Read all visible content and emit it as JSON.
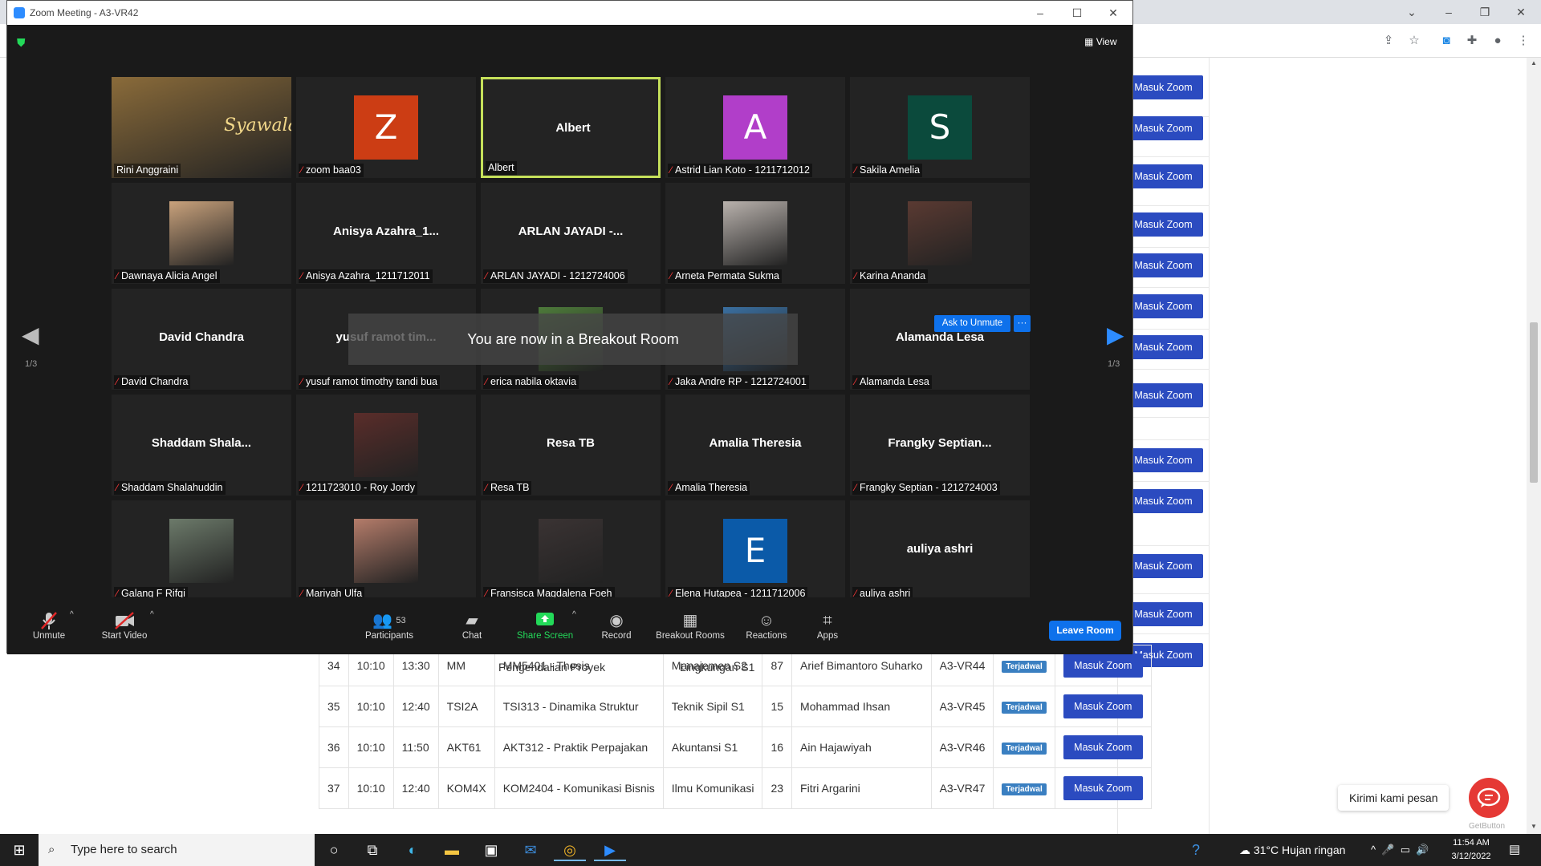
{
  "zoom": {
    "window_title": "Zoom Meeting - A3-VR42",
    "view_label": "View",
    "page_left": "1/3",
    "page_right": "1/3",
    "breakout_message": "You are now in a Breakout Room",
    "ask_unmute_label": "Ask to Unmute",
    "more_label": "···",
    "tiles": [
      {
        "name": "Rini Anggraini",
        "kind": "photo",
        "photo_text": "Syawala",
        "color": "#8a6b3a"
      },
      {
        "name": "zoom baa03",
        "kind": "letter",
        "letter": "Z",
        "color": "#cc3d14"
      },
      {
        "name": "Albert",
        "kind": "bigname",
        "big": "Albert",
        "active": true
      },
      {
        "name": "Astrid Lian Koto - 1211712012",
        "kind": "letter",
        "letter": "A",
        "color": "#b13ec9"
      },
      {
        "name": "Sakila Amelia",
        "kind": "letter",
        "letter": "S",
        "color": "#0b4a3c"
      },
      {
        "name": "Dawnaya Alicia Angel",
        "kind": "photo",
        "color": "#c9a27c"
      },
      {
        "name": "Anisya Azahra_1211712011",
        "kind": "bigname",
        "big": "Anisya  Azahra_1..."
      },
      {
        "name": "ARLAN JAYADI - 1212724006",
        "kind": "bigname",
        "big": "ARLAN JAYADI -..."
      },
      {
        "name": "Arneta Permata Sukma",
        "kind": "photo",
        "color": "#b9b2ad"
      },
      {
        "name": "Karina Ananda",
        "kind": "photo",
        "color": "#5a3a32"
      },
      {
        "name": "David Chandra",
        "kind": "bigname",
        "big": "David Chandra"
      },
      {
        "name": "yusuf ramot timothy tandi bua",
        "kind": "bigname",
        "big": "yusuf ramot tim..."
      },
      {
        "name": "erica nabila oktavia",
        "kind": "photo",
        "color": "#4d7a3a"
      },
      {
        "name": "Jaka Andre RP - 1212724001",
        "kind": "photo",
        "color": "#3a6fa0"
      },
      {
        "name": "Alamanda Lesa",
        "kind": "bigname",
        "big": "Alamanda Lesa"
      },
      {
        "name": "Shaddam Shalahuddin",
        "kind": "bigname",
        "big": "Shaddam  Shala..."
      },
      {
        "name": "1211723010 - Roy Jordy",
        "kind": "photo",
        "color": "#5a2d2a"
      },
      {
        "name": "Resa TB",
        "kind": "bigname",
        "big": "Resa TB"
      },
      {
        "name": "Amalia Theresia",
        "kind": "bigname",
        "big": "Amalia Theresia"
      },
      {
        "name": "Frangky Septian - 1212724003",
        "kind": "bigname",
        "big": "Frangky  Septian..."
      },
      {
        "name": "Galang F Rifqi",
        "kind": "photo",
        "color": "#6c7a6a"
      },
      {
        "name": "Mariyah Ulfa",
        "kind": "photo",
        "color": "#b47c6a"
      },
      {
        "name": "Fransisca Magdalena Foeh",
        "kind": "photo",
        "color": "#3a3333"
      },
      {
        "name": "Elena Hutapea - 1211712006",
        "kind": "letter",
        "letter": "E",
        "color": "#0b5aa8"
      },
      {
        "name": "auliya ashri",
        "kind": "bigname",
        "big": "auliya ashri"
      }
    ],
    "controls": {
      "unmute": "Unmute",
      "start_video": "Start Video",
      "participants": "Participants",
      "participants_count": "53",
      "chat": "Chat",
      "share_screen": "Share Screen",
      "record": "Record",
      "breakout_rooms": "Breakout Rooms",
      "reactions": "Reactions",
      "apps": "Apps",
      "leave_room": "Leave Room"
    }
  },
  "browser": {
    "masuk_zoom_label": "Masuk Zoom",
    "partial_row": {
      "course": "Pengendalian Proyek",
      "program": "Lingkungan S1"
    },
    "rows": [
      {
        "no": "34",
        "start": "10:10",
        "end": "13:30",
        "class": "MM",
        "course": "MM5401 - Thesis",
        "program": "Manajemen S2",
        "count": "87",
        "lecturer": "Arief Bimantoro Suharko",
        "room": "A3-VR44",
        "status": "Terjadwal"
      },
      {
        "no": "35",
        "start": "10:10",
        "end": "12:40",
        "class": "TSI2A",
        "course": "TSI313 - Dinamika Struktur",
        "program": "Teknik Sipil S1",
        "count": "15",
        "lecturer": "Mohammad Ihsan",
        "room": "A3-VR45",
        "status": "Terjadwal"
      },
      {
        "no": "36",
        "start": "10:10",
        "end": "11:50",
        "class": "AKT61",
        "course": "AKT312 - Praktik Perpajakan",
        "program": "Akuntansi S1",
        "count": "16",
        "lecturer": "Ain Hajawiyah",
        "room": "A3-VR46",
        "status": "Terjadwal"
      },
      {
        "no": "37",
        "start": "10:10",
        "end": "12:40",
        "class": "KOM4X",
        "course": "KOM2404 - Komunikasi Bisnis",
        "program": "Ilmu Komunikasi",
        "count": "23",
        "lecturer": "Fitri Argarini",
        "room": "A3-VR47",
        "status": "Terjadwal"
      }
    ],
    "chat_prompt": "Kirimi kami pesan",
    "getbutton_label": "GetButton"
  },
  "taskbar": {
    "search_placeholder": "Type here to search",
    "weather": "31°C  Hujan ringan",
    "time": "11:54 AM",
    "date": "3/12/2022"
  }
}
